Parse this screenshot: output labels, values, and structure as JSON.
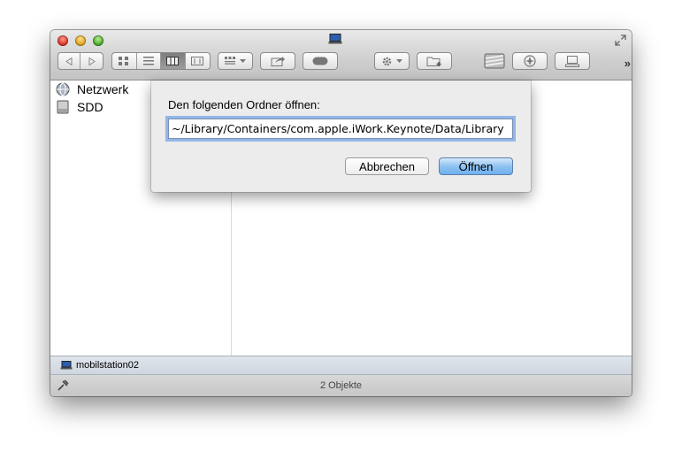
{
  "window": {
    "title_icon": "computer-icon"
  },
  "toolbar": {
    "more_label": "»",
    "colors": {
      "active_segment": "#8a8a8a"
    }
  },
  "sidebar": {
    "items": [
      {
        "label": "Netzwerk",
        "icon": "network-globe-icon"
      },
      {
        "label": "SDD",
        "icon": "hard-drive-icon"
      }
    ]
  },
  "pathbar": {
    "label": "mobilstation02",
    "icon": "computer-icon"
  },
  "status": {
    "text": "2 Objekte"
  },
  "goto_sheet": {
    "label": "Den folgenden Ordner öffnen:",
    "path_value": "~/Library/Containers/com.apple.iWork.Keynote/Data/Library",
    "cancel_label": "Abbrechen",
    "open_label": "Öffnen",
    "colors": {
      "default_button": "#8fc2f2",
      "focus_ring": "#6ea0e6"
    }
  }
}
